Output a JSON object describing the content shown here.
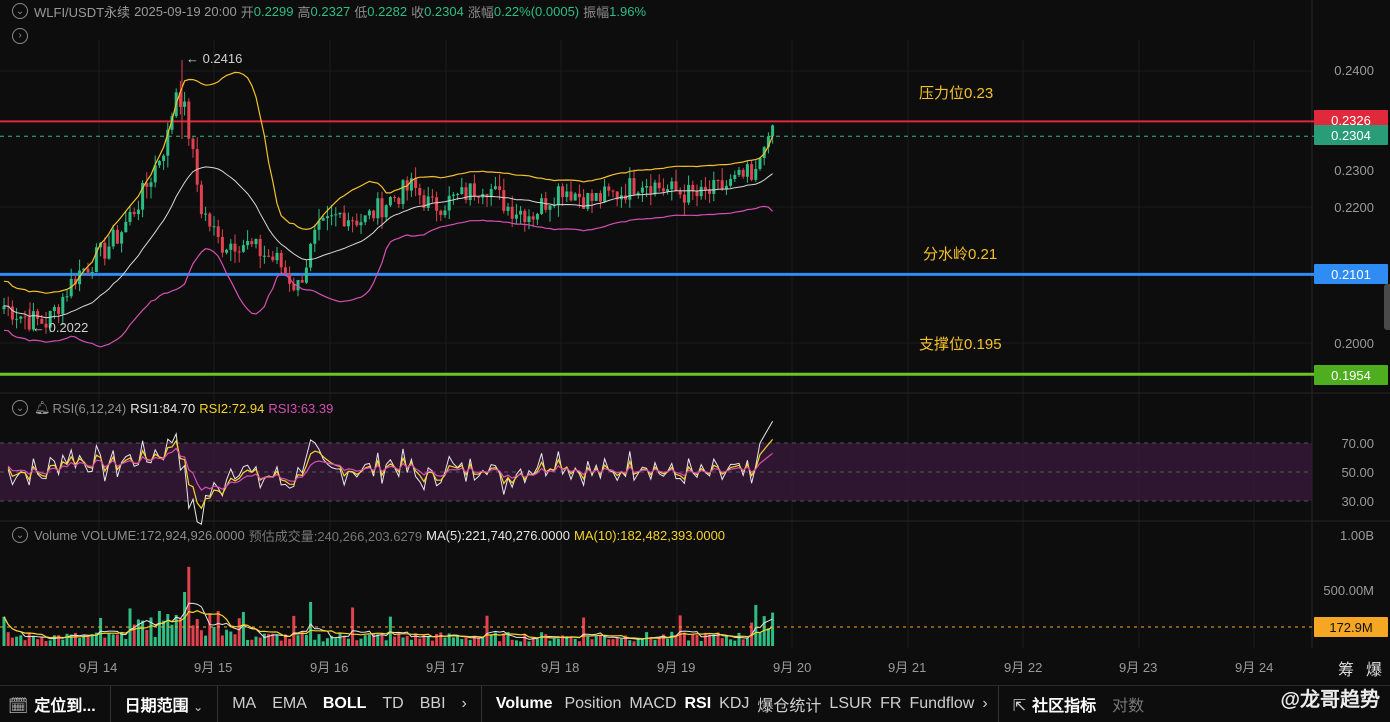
{
  "header": {
    "symbol": "WLFI/USDT永续",
    "datetime": "2025-09-19 20:00",
    "open_label": "开",
    "open": "0.2299",
    "high_label": "高",
    "high": "0.2327",
    "low_label": "低",
    "low": "0.2282",
    "close_label": "收",
    "close": "0.2304",
    "change_label": "涨幅",
    "change": "0.22%(0.0005)",
    "amp_label": "振幅",
    "amp": "1.96%"
  },
  "annotations": {
    "resistance": "压力位0.23",
    "watershed": "分水岭0.21",
    "support": "支撑位0.195",
    "high_marker": "← 0.2416",
    "low_marker": "← 0.2022"
  },
  "price_axis": [
    "0.2400",
    "0.2300",
    "0.2200",
    "0.2000"
  ],
  "price_tags": {
    "red": "0.2326",
    "current": "0.2304",
    "blue": "0.2101",
    "green": "0.1954"
  },
  "rsi": {
    "title": "RSI(6,12,24)",
    "rsi1": "RSI1:84.70",
    "rsi2": "RSI2:72.94",
    "rsi3": "RSI3:63.39",
    "axis": [
      "70.00",
      "50.00",
      "30.00"
    ]
  },
  "volume": {
    "title": "Volume",
    "volume": "VOLUME:172,924,926.0000",
    "est": "预估成交量:240,266,203.6279",
    "ma5": "MA(5):221,740,276.0000",
    "ma10": "MA(10):182,482,393.0000",
    "axis": [
      "1.00B",
      "500.00M"
    ],
    "tag": "172.9M"
  },
  "x_axis": [
    "9月 14",
    "9月 15",
    "9月 16",
    "9月 17",
    "9月 18",
    "9月 19",
    "9月 20",
    "9月 21",
    "9月 22",
    "9月 23",
    "9月 24"
  ],
  "x_right_labels": [
    "筹",
    "爆"
  ],
  "toolbar": {
    "locate": "定位到...",
    "date_range": "日期范围",
    "indicators": [
      "MA",
      "EMA",
      "BOLL",
      "TD",
      "BBI"
    ],
    "sub_indicators": [
      "Volume",
      "Position",
      "MACD",
      "RSI",
      "KDJ",
      "爆仓统计",
      "LSUR",
      "FR",
      "Fundflow"
    ],
    "community": "社区指标",
    "extra": "对数"
  },
  "watermark": "@龙哥趋势",
  "colors": {
    "up": "#2ebd85",
    "down": "#e0424f",
    "red_line": "#e0293b",
    "blue_line": "#2f8cf5",
    "green_line": "#6cc428",
    "yellow": "#f5c12b",
    "boll_mid": "#d8d8d8",
    "boll_low": "#d64fb4"
  }
}
